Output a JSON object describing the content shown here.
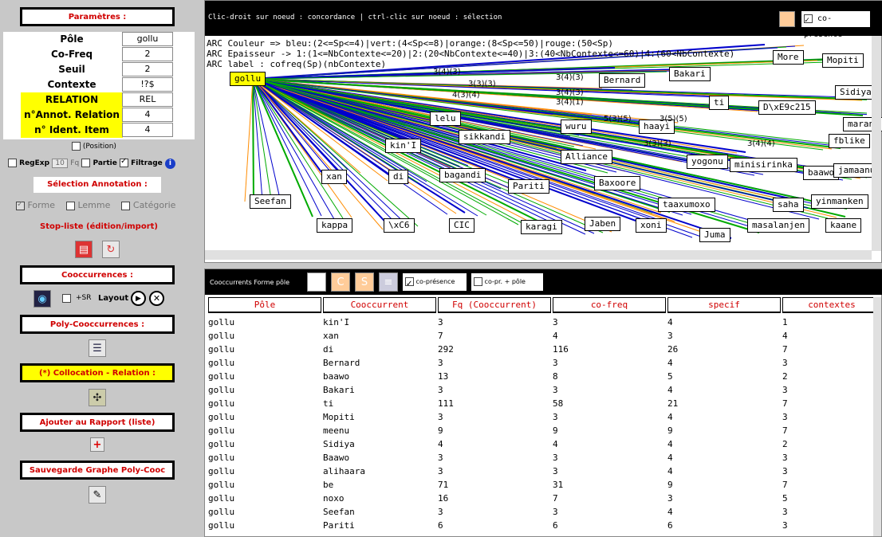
{
  "left": {
    "params_title": "Paramètres :",
    "params": [
      {
        "label": "Pôle",
        "value": "gollu",
        "highlight": false
      },
      {
        "label": "Co-Freq",
        "value": "2",
        "highlight": false
      },
      {
        "label": "Seuil",
        "value": "2",
        "highlight": false
      },
      {
        "label": "Contexte",
        "value": "!?$",
        "highlight": false
      },
      {
        "label": "RELATION",
        "value": "REL",
        "highlight": true
      },
      {
        "label": "n°Annot. Relation",
        "value": "4",
        "highlight": true
      },
      {
        "label": "n° Ident. Item",
        "value": "4",
        "highlight": true
      }
    ],
    "position_label": "(Position)",
    "regexp_label": "RegExp",
    "regexp_value": "10",
    "fq_label": "Fq",
    "partie_label": "Partie",
    "filtrage_label": "Filtrage",
    "selection_title": "Sélection Annotation :",
    "forme_label": "Forme",
    "lemme_label": "Lemme",
    "categorie_label": "Catégorie",
    "stoplist_label": "Stop-liste (édition/import)",
    "cooc_title": "Cooccurrences :",
    "sr_label": "+SR",
    "layout_label": "Layout",
    "polycooc_title": "Poly-Cooccurrences :",
    "collocation_title": "(*) Collocation - Relation :",
    "rapport_title": "Ajouter au Rapport (liste)",
    "sauvegarde_title": "Sauvegarde Graphe Poly-Cooc"
  },
  "graph": {
    "toolbar_text": "Clic-droit sur noeud : concordance | ctrl-clic sur noeud : sélection",
    "copresence_label": "co-présence",
    "info_lines": [
      "ARC Couleur => bleu:(2<=Sp<=4)|vert:(4<Sp<=8)|orange:(8<Sp<=50)|rouge:(50<Sp)",
      "ARC Epaisseur -> 1:(1<=NbContexte<=20)|2:(20<NbContexte<=40)|3:(40<NbContexte<=60)|4:(60<NbContexte)",
      "ARC label : cofreq(Sp)(nbContexte)"
    ],
    "pole": "gollu",
    "nodes": [
      "More",
      "Mopiti",
      "Bernard",
      "Bakari",
      "Sidiya",
      "ti",
      "D\\xE9c215",
      "marant",
      "lelu",
      "wuru",
      "haayi",
      "fblike",
      "kin'I",
      "sikkandi",
      "Alliance",
      "yogonu",
      "minisirinka",
      "baawo",
      "jamaanu",
      "xan",
      "di",
      "bagandi",
      "Pariti",
      "Baxoore",
      "Seefan",
      "taaxumoxo",
      "saha",
      "yinmanken",
      "kappa",
      "\\xC6",
      "CIC",
      "karagi",
      "Jaben",
      "xoni",
      "masalanjen",
      "kaane",
      "Juma"
    ],
    "edge_labels": [
      "3(4)(3)",
      "3(3)(3)",
      "3(4)(3)",
      "4(3)(4)",
      "3(4)(3)",
      "3(4)(1)",
      "5(3)(5)",
      "3(3)(3)",
      "3(5)(5)",
      "3(4)(4)"
    ]
  },
  "table": {
    "toolbar_title": "Cooccurrents Forme pôle",
    "copresence_label": "co-présence",
    "copr_pole_label": "co-pr. + pôle",
    "columns": [
      "Pôle",
      "Cooccurrent",
      "Fq (Cooccurrent)",
      "co-freq",
      "specif",
      "contextes"
    ],
    "rows": [
      [
        "gollu",
        "kin'I",
        "3",
        "3",
        "4",
        "1"
      ],
      [
        "gollu",
        "xan",
        "7",
        "4",
        "3",
        "4"
      ],
      [
        "gollu",
        "di",
        "292",
        "116",
        "26",
        "7"
      ],
      [
        "gollu",
        "Bernard",
        "3",
        "3",
        "4",
        "3"
      ],
      [
        "gollu",
        "baawo",
        "13",
        "8",
        "5",
        "2"
      ],
      [
        "gollu",
        "Bakari",
        "3",
        "3",
        "4",
        "3"
      ],
      [
        "gollu",
        "ti",
        "111",
        "58",
        "21",
        "7"
      ],
      [
        "gollu",
        "Mopiti",
        "3",
        "3",
        "4",
        "3"
      ],
      [
        "gollu",
        "meenu",
        "9",
        "9",
        "9",
        "7"
      ],
      [
        "gollu",
        "Sidiya",
        "4",
        "4",
        "4",
        "2"
      ],
      [
        "gollu",
        "Baawo",
        "3",
        "3",
        "4",
        "3"
      ],
      [
        "gollu",
        "alihaara",
        "3",
        "3",
        "4",
        "3"
      ],
      [
        "gollu",
        "be",
        "71",
        "31",
        "9",
        "7"
      ],
      [
        "gollu",
        "noxo",
        "16",
        "7",
        "3",
        "5"
      ],
      [
        "gollu",
        "Seefan",
        "3",
        "3",
        "4",
        "3"
      ],
      [
        "gollu",
        "Pariti",
        "6",
        "6",
        "6",
        "3"
      ]
    ]
  }
}
